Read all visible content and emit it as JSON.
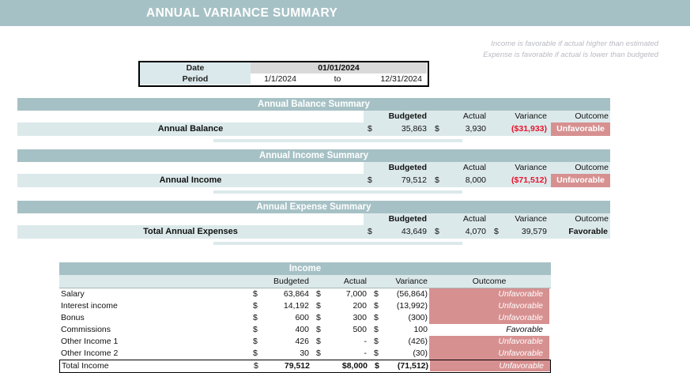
{
  "currency": "$",
  "header": {
    "title": "ANNUAL VARIANCE SUMMARY"
  },
  "notes": {
    "line1": "Income is favorable if actual higher than estimated",
    "line2": "Expense is favorable if actual is lower than budgeted"
  },
  "date_box": {
    "date_label": "Date",
    "date_value": "01/01/2024",
    "period_label": "Period",
    "period_start": "1/1/2024",
    "period_separator": "to",
    "period_end": "12/31/2024"
  },
  "column_headers": {
    "budgeted": "Budgeted",
    "actual": "Actual",
    "variance": "Variance",
    "outcome": "Outcome"
  },
  "summaries": [
    {
      "title": "Annual Balance Summary",
      "row_label": "Annual Balance",
      "budgeted": "35,863",
      "actual": "3,930",
      "variance_currency": "",
      "variance": "($31,933)",
      "variance_style": "negative",
      "outcome": "Unfavorable",
      "outcome_state": "unfavorable"
    },
    {
      "title": "Annual Income Summary",
      "row_label": "Annual Income",
      "budgeted": "79,512",
      "actual": "8,000",
      "variance_currency": "",
      "variance": "($71,512)",
      "variance_style": "negative",
      "outcome": "Unfavorable",
      "outcome_state": "unfavorable"
    },
    {
      "title": "Annual Expense Summary",
      "row_label": "Total Annual Expenses",
      "budgeted": "43,649",
      "actual": "4,070",
      "variance_currency": "$",
      "variance": "39,579",
      "variance_style": "positive",
      "outcome": "Favorable",
      "outcome_state": "favorable"
    }
  ],
  "income_table": {
    "title": "Income",
    "rows": [
      {
        "label": "Salary",
        "budgeted": "63,864",
        "actual": "7,000",
        "variance": "(56,864)",
        "outcome": "Unfavorable",
        "outcome_state": "unfavorable"
      },
      {
        "label": "Interest income",
        "budgeted": "14,192",
        "actual": "200",
        "variance": "(13,992)",
        "outcome": "Unfavorable",
        "outcome_state": "unfavorable"
      },
      {
        "label": "Bonus",
        "budgeted": "600",
        "actual": "300",
        "variance": "(300)",
        "outcome": "Unfavorable",
        "outcome_state": "unfavorable"
      },
      {
        "label": "Commissions",
        "budgeted": "400",
        "actual": "500",
        "variance": "100",
        "outcome": "Favorable",
        "outcome_state": "favorable"
      },
      {
        "label": "Other Income 1",
        "budgeted": "426",
        "actual": "-",
        "variance": "(426)",
        "outcome": "Unfavorable",
        "outcome_state": "unfavorable"
      },
      {
        "label": "Other Income 2",
        "budgeted": "30",
        "actual": "-",
        "variance": "(30)",
        "outcome": "Unfavorable",
        "outcome_state": "unfavorable"
      }
    ],
    "total_row": {
      "label": "Total Income",
      "budgeted": "79,512",
      "actual_combined": "$8,000",
      "variance": "(71,512)",
      "outcome": "Unfavorable",
      "outcome_state": "unfavorable"
    }
  },
  "colors": {
    "band": "#a6c1c5",
    "row_tint": "#dce9eb",
    "unfavorable_fill": "#d79090",
    "negative_text": "#e8132b",
    "input_fill": "#d9d9d9"
  }
}
